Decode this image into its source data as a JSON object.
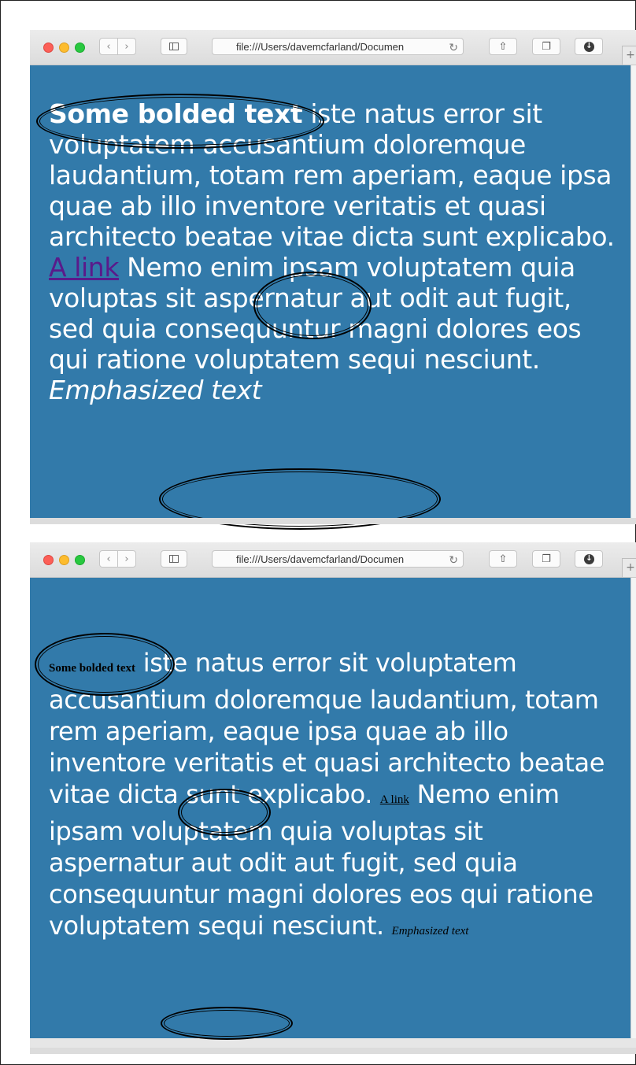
{
  "browser_windows": [
    {
      "address_bar": {
        "url": "file:///Users/davemcfarland/Documen"
      },
      "content": {
        "bold_text": "Some bolded text",
        "text_before_link": " iste natus error sit voluptatem accusantium doloremque laudantium, totam rem aperiam, eaque ipsa quae ab illo inventore veritatis et quasi architecto beatae vitae dicta sunt explicabo. ",
        "link_text": "A link",
        "text_after_link": " Nemo enim ipsam voluptatem quia voluptas sit aspernatur aut odit aut fugit, sed quia consequuntur magni dolores eos qui ratione voluptatem sequi nesciunt. ",
        "emphasized_text": "Emphasized text"
      }
    },
    {
      "address_bar": {
        "url": "file:///Users/davemcfarland/Documen"
      },
      "content": {
        "bold_text": "Some bolded text",
        "text_before_link": " iste natus error sit voluptatem accusantium doloremque laudantium, totam rem aperiam, eaque ipsa quae ab illo inventore veritatis et quasi architecto beatae vitae dicta sunt explicabo. ",
        "link_text": "A link",
        "text_after_link": " Nemo enim ipsam voluptatem quia voluptas sit aspernatur aut odit aut fugit, sed quia consequuntur magni dolores eos qui ratione voluptatem sequi nesciunt. ",
        "emphasized_text": "Emphasized text"
      }
    }
  ],
  "icons": {
    "back": "chevron-left-icon",
    "forward": "chevron-right-icon",
    "sidebar": "sidebar-icon",
    "reload": "reload-icon",
    "share": "share-icon",
    "tabs": "tabs-icon",
    "downloads": "download-icon",
    "new_tab": "plus-icon"
  },
  "colors": {
    "page_background": "#327aaa",
    "body_text": "#ffffff",
    "link_styled": "#5a1a8b",
    "default_inline_text": "#000000",
    "annotation_ellipse": "#000000"
  }
}
